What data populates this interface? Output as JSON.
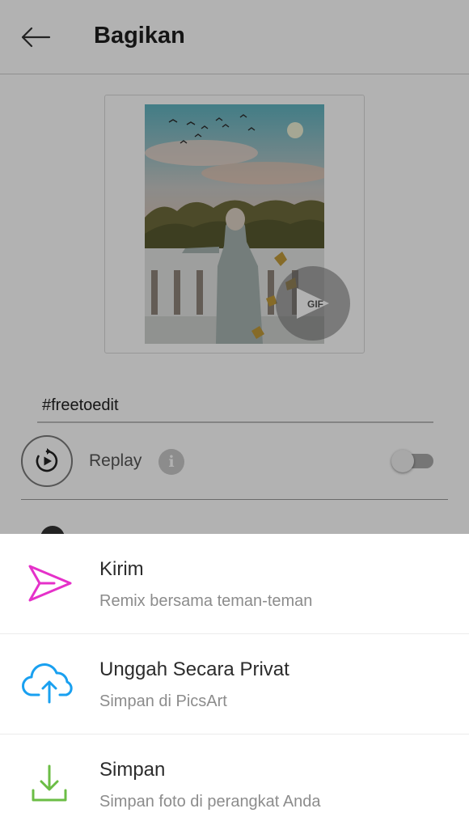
{
  "header": {
    "title": "Bagikan",
    "back_icon": "arrow-left-icon"
  },
  "preview": {
    "badge_label": "GIF",
    "badge_icon": "play-icon"
  },
  "caption": {
    "value": "#freetoedit"
  },
  "replay": {
    "label": "Replay",
    "info_glyph": "i",
    "enabled": false
  },
  "sheet": {
    "items": [
      {
        "title": "Kirim",
        "subtitle": "Remix bersama teman-teman",
        "icon": "send-icon",
        "color": "#e531c9"
      },
      {
        "title": "Unggah Secara Privat",
        "subtitle": "Simpan di PicsArt",
        "icon": "cloud-upload-icon",
        "color": "#19a0f0"
      },
      {
        "title": "Simpan",
        "subtitle": "Simpan foto di perangkat Anda",
        "icon": "download-icon",
        "color": "#6bbd45"
      }
    ]
  }
}
